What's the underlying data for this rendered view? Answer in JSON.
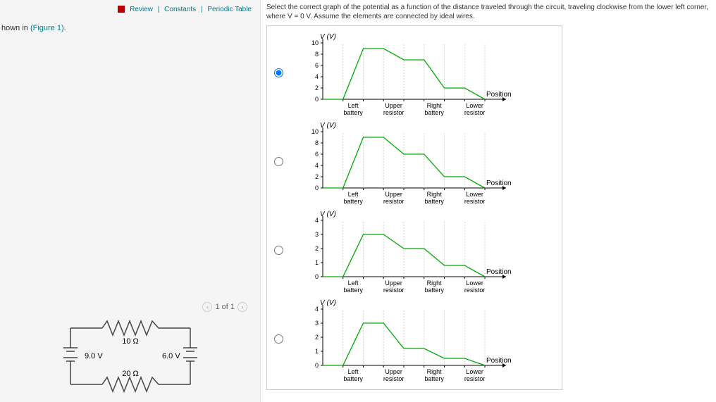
{
  "hint_prefix": "hown in ",
  "hint_link": "(Figure 1)",
  "hint_suffix": ".",
  "links": {
    "review": "Review",
    "constants": "Constants",
    "periodic": "Periodic Table"
  },
  "fignav": "1 of 1",
  "question": "Select the correct graph of the potential as a function of the distance traveled through the circuit, traveling clockwise from the lower left corner, where V = 0 V. Assume the elements are connected by ideal wires.",
  "circuit": {
    "r_top": "10 Ω",
    "r_bottom": "20 Ω",
    "v_left": "9.0 V",
    "v_right": "6.0 V"
  },
  "segments": [
    "Left",
    "battery",
    "Upper",
    "resistor",
    "Right",
    "battery",
    "Lower",
    "resistor"
  ],
  "axis_y": "V (V)",
  "axis_x": "Position",
  "chart_data": [
    {
      "type": "line",
      "ylabel": "V (V)",
      "xlabel": "Position",
      "yticks": [
        0,
        2,
        4,
        6,
        8,
        10
      ],
      "segments": [
        "Left battery",
        "Upper resistor",
        "Right battery",
        "Lower resistor"
      ],
      "points": [
        [
          0,
          0
        ],
        [
          1,
          0
        ],
        [
          2,
          9
        ],
        [
          3,
          9
        ],
        [
          4,
          7
        ],
        [
          5,
          7
        ],
        [
          6,
          2
        ],
        [
          7,
          2
        ],
        [
          8,
          0
        ]
      ],
      "selected": true
    },
    {
      "type": "line",
      "ylabel": "V (V)",
      "xlabel": "Position",
      "yticks": [
        0,
        2,
        4,
        6,
        8,
        10
      ],
      "segments": [
        "Left battery",
        "Upper resistor",
        "Right battery",
        "Lower resistor"
      ],
      "points": [
        [
          0,
          0
        ],
        [
          1,
          0
        ],
        [
          2,
          9
        ],
        [
          3,
          9
        ],
        [
          4,
          6
        ],
        [
          5,
          6
        ],
        [
          6,
          2
        ],
        [
          7,
          2
        ],
        [
          8,
          0
        ]
      ],
      "selected": false
    },
    {
      "type": "line",
      "ylabel": "V (V)",
      "xlabel": "Position",
      "yticks": [
        0,
        1,
        2,
        3,
        4
      ],
      "segments": [
        "Left battery",
        "Upper resistor",
        "Right battery",
        "Lower resistor"
      ],
      "points": [
        [
          0,
          0
        ],
        [
          1,
          0
        ],
        [
          2,
          3
        ],
        [
          3,
          3
        ],
        [
          4,
          2
        ],
        [
          5,
          2
        ],
        [
          6,
          0.8
        ],
        [
          7,
          0.8
        ],
        [
          8,
          0
        ]
      ],
      "selected": false
    },
    {
      "type": "line",
      "ylabel": "V (V)",
      "xlabel": "Position",
      "yticks": [
        0,
        1,
        2,
        3,
        4
      ],
      "segments": [
        "Left battery",
        "Upper resistor",
        "Right battery",
        "Lower resistor"
      ],
      "points": [
        [
          0,
          0
        ],
        [
          1,
          0
        ],
        [
          2,
          3
        ],
        [
          3,
          3
        ],
        [
          4,
          1.2
        ],
        [
          5,
          1.2
        ],
        [
          6,
          0.5
        ],
        [
          7,
          0.5
        ],
        [
          8,
          0
        ]
      ],
      "selected": false
    }
  ]
}
